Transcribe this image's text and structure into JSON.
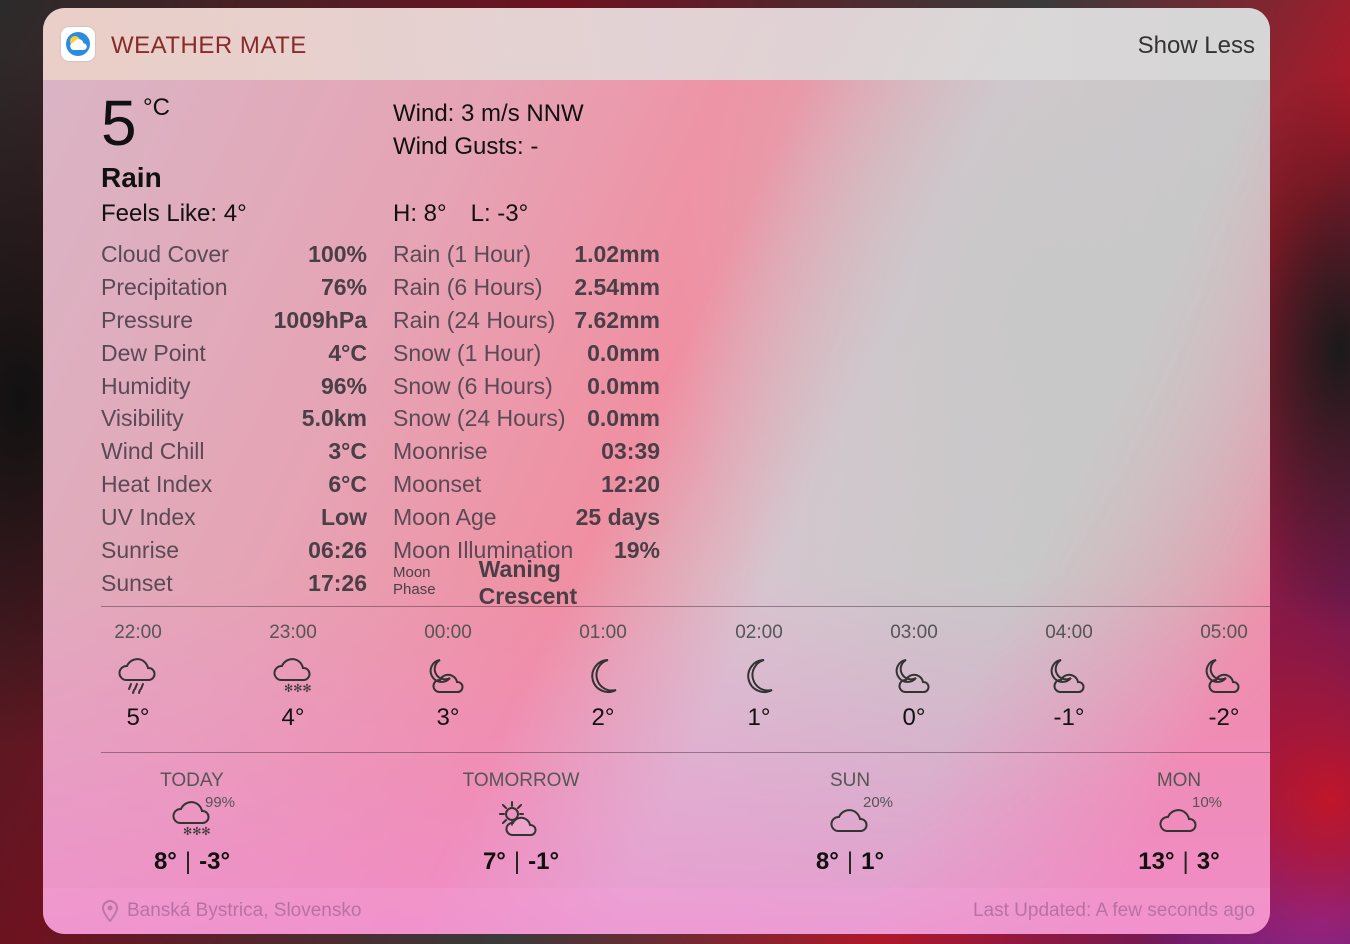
{
  "app": {
    "name": "WEATHER MATE",
    "show_less": "Show Less"
  },
  "current": {
    "temp": "5",
    "unit": "°C",
    "condition": "Rain",
    "feels_like": "Feels Like: 4°",
    "wind": "Wind: 3 m/s NNW",
    "gusts": "Wind Gusts: -",
    "high": "H: 8°",
    "low": "L: -3°"
  },
  "stats_left": [
    {
      "label": "Cloud Cover",
      "value": "100%"
    },
    {
      "label": "Precipitation",
      "value": "76%"
    },
    {
      "label": "Pressure",
      "value": "1009hPa"
    },
    {
      "label": "Dew Point",
      "value": "4°C"
    },
    {
      "label": "Humidity",
      "value": "96%"
    },
    {
      "label": "Visibility",
      "value": "5.0km"
    },
    {
      "label": "Wind Chill",
      "value": "3°C"
    },
    {
      "label": "Heat Index",
      "value": "6°C"
    },
    {
      "label": "UV Index",
      "value": "Low"
    },
    {
      "label": "Sunrise",
      "value": "06:26"
    },
    {
      "label": "Sunset",
      "value": "17:26"
    }
  ],
  "stats_right": [
    {
      "label": "Rain (1 Hour)",
      "value": "1.02mm"
    },
    {
      "label": "Rain (6 Hours)",
      "value": "2.54mm"
    },
    {
      "label": "Rain (24 Hours)",
      "value": "7.62mm"
    },
    {
      "label": "Snow (1 Hour)",
      "value": "0.0mm"
    },
    {
      "label": "Snow (6 Hours)",
      "value": "0.0mm"
    },
    {
      "label": "Snow (24 Hours)",
      "value": "0.0mm"
    },
    {
      "label": "Moonrise",
      "value": "03:39"
    },
    {
      "label": "Moonset",
      "value": "12:20"
    },
    {
      "label": "Moon Age",
      "value": "25 days"
    },
    {
      "label": "Moon Illumination",
      "value": "19%"
    }
  ],
  "moon_phase": {
    "label": "Moon Phase",
    "value": "Waning Crescent"
  },
  "hourly": [
    {
      "time": "22:00",
      "icon": "cloud-rain-icon",
      "temp": "5°"
    },
    {
      "time": "23:00",
      "icon": "cloud-snow-icon",
      "temp": "4°"
    },
    {
      "time": "00:00",
      "icon": "moon-cloud-icon",
      "temp": "3°"
    },
    {
      "time": "01:00",
      "icon": "moon-icon",
      "temp": "2°"
    },
    {
      "time": "02:00",
      "icon": "moon-icon",
      "temp": "1°"
    },
    {
      "time": "03:00",
      "icon": "moon-cloud-icon",
      "temp": "0°"
    },
    {
      "time": "04:00",
      "icon": "moon-cloud-icon",
      "temp": "-1°"
    },
    {
      "time": "05:00",
      "icon": "moon-cloud-icon",
      "temp": "-2°"
    }
  ],
  "daily": [
    {
      "name": "TODAY",
      "icon": "cloud-snow-icon",
      "precip": "99%",
      "high": "8°",
      "low": "-3°"
    },
    {
      "name": "TOMORROW",
      "icon": "sun-cloud-icon",
      "precip": "",
      "high": "7°",
      "low": "-1°"
    },
    {
      "name": "SUN",
      "icon": "cloud-icon",
      "precip": "20%",
      "high": "8°",
      "low": "1°"
    },
    {
      "name": "MON",
      "icon": "cloud-icon",
      "precip": "10%",
      "high": "13°",
      "low": "3°"
    }
  ],
  "footer": {
    "location": "Banská Bystrica, Slovensko",
    "updated": "Last Updated: A few seconds ago"
  },
  "colors": {
    "app_name": "#8a2a2a",
    "label": "#5a4a55",
    "value": "#4a3f46"
  }
}
